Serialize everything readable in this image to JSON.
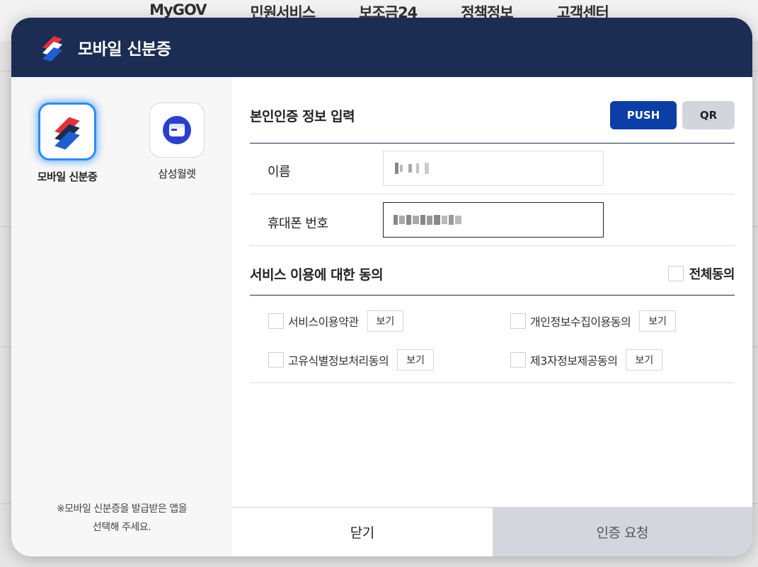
{
  "background": {
    "nav": [
      "MyGOV",
      "민원서비스",
      "보조금24",
      "정책정보",
      "고객센터"
    ]
  },
  "modal": {
    "title": "모바일 신분증",
    "apps": [
      {
        "label": "모바일 신분증",
        "icon": "mobile-id-icon",
        "selected": true
      },
      {
        "label": "삼성월렛",
        "icon": "samsung-wallet-icon",
        "selected": false
      }
    ],
    "note_line1": "※모바일 신분증을 발급받은 앱을",
    "note_line2": "선택해 주세요.",
    "auth": {
      "title": "본인인증 정보 입력",
      "push_label": "PUSH",
      "qr_label": "QR",
      "name_label": "이름",
      "phone_label": "휴대폰 번호"
    },
    "consent": {
      "title": "서비스 이용에 대한 동의",
      "all_label": "전체동의",
      "view_label": "보기",
      "items": [
        "서비스이용약관",
        "개인정보수집이용동의",
        "고유식별정보처리동의",
        "제3자정보제공동의"
      ]
    },
    "footer": {
      "close_label": "닫기",
      "request_label": "인증 요청"
    },
    "colors": {
      "header_bg": "#1c2d53",
      "push_active": "#0b3ea6",
      "request_bg": "#d3d7dd"
    }
  }
}
